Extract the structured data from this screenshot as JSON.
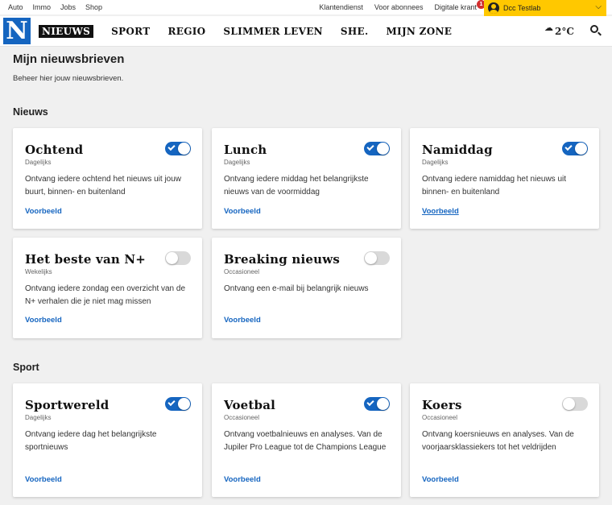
{
  "topbar": {
    "links": [
      "Auto",
      "Immo",
      "Jobs",
      "Shop"
    ],
    "service": "Klantendienst",
    "subscribers": "Voor abonnees",
    "digital": "Digitale krant",
    "notification_count": "1",
    "user_name": "Dcc Testlab"
  },
  "nav": {
    "logo": "N",
    "items": [
      "NIEUWS",
      "SPORT",
      "REGIO",
      "SLIMMER LEVEN",
      "SHE.",
      "MIJN ZONE"
    ],
    "active": "NIEUWS",
    "temperature": "2°C"
  },
  "page": {
    "title": "Mijn nieuwsbrieven",
    "subtitle": "Beheer hier jouw nieuwsbrieven."
  },
  "sections": [
    {
      "title": "Nieuws",
      "cards": [
        {
          "title": "Ochtend",
          "freq": "Dagelijks",
          "desc": "Ontvang iedere ochtend het nieuws uit jouw buurt, binnen- en buitenland",
          "link": "Voorbeeld",
          "enabled": true
        },
        {
          "title": "Lunch",
          "freq": "Dagelijks",
          "desc": "Ontvang iedere middag het belangrijkste nieuws van de voormiddag",
          "link": "Voorbeeld",
          "enabled": true
        },
        {
          "title": "Namiddag",
          "freq": "Dagelijks",
          "desc": "Ontvang iedere namiddag het nieuws uit binnen- en buitenland",
          "link": "Voorbeeld",
          "enabled": true
        },
        {
          "title": "Het beste van N+",
          "freq": "Wekelijks",
          "desc": "Ontvang iedere zondag een overzicht van de N+ verhalen die je niet mag missen",
          "link": "Voorbeeld",
          "enabled": false
        },
        {
          "title": "Breaking nieuws",
          "freq": "Occasioneel",
          "desc": "Ontvang een e-mail bij belangrijk nieuws",
          "link": "Voorbeeld",
          "enabled": false
        }
      ]
    },
    {
      "title": "Sport",
      "cards": [
        {
          "title": "Sportwereld",
          "freq": "Dagelijks",
          "desc": "Ontvang iedere dag het belangrijkste sportnieuws",
          "link": "Voorbeeld",
          "enabled": true
        },
        {
          "title": "Voetbal",
          "freq": "Occasioneel",
          "desc": "Ontvang voetbalnieuws en analyses. Van de Jupiler Pro League tot de Champions League",
          "link": "Voorbeeld",
          "enabled": true
        },
        {
          "title": "Koers",
          "freq": "Occasioneel",
          "desc": "Ontvang koersnieuws en analyses. Van de voorjaarsklassiekers tot het veldrijden",
          "link": "Voorbeeld",
          "enabled": false
        }
      ]
    }
  ],
  "colors": {
    "brand_blue": "#1565c0",
    "user_yellow": "#ffc800",
    "toggle_off": "#d9d9d9"
  }
}
